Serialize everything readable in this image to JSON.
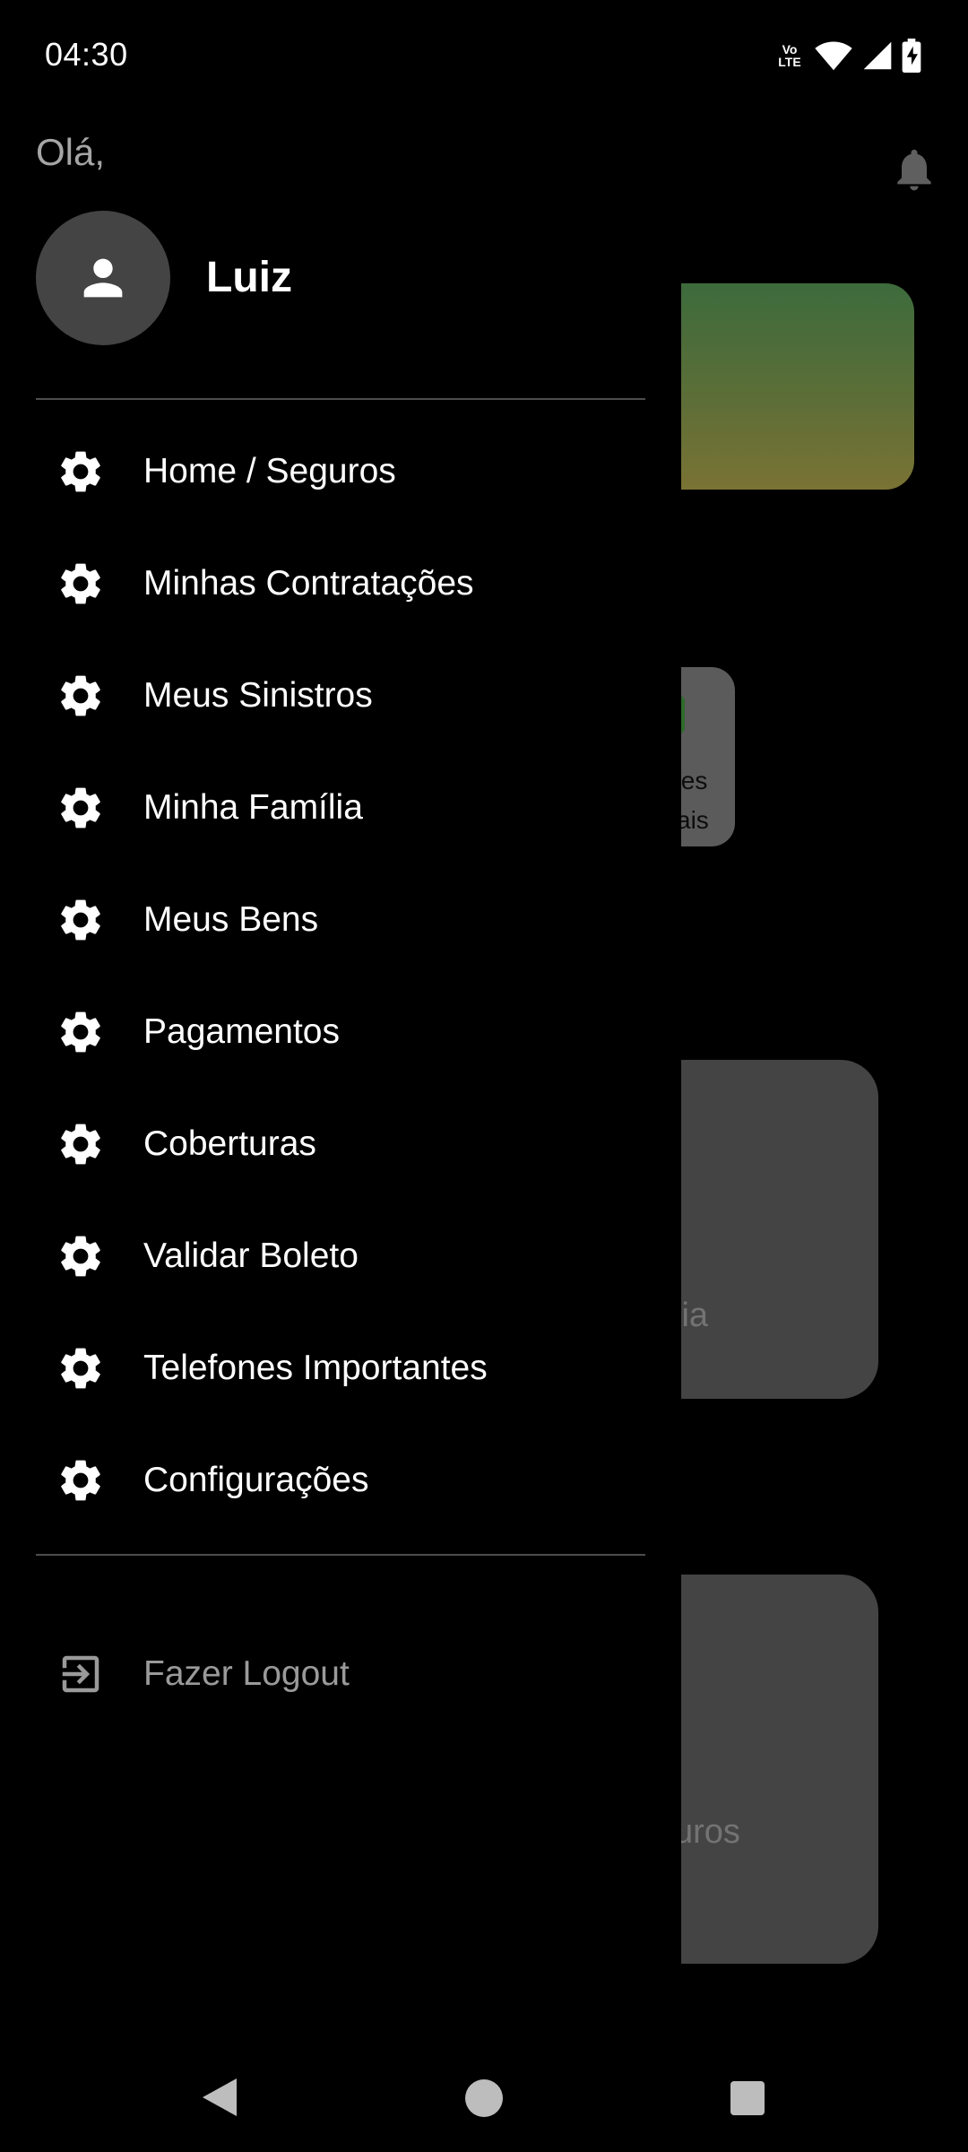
{
  "status_bar": {
    "time": "04:30",
    "volte_top": "Vo",
    "volte_bottom": "LTE",
    "icons": [
      "volte-icon",
      "wifi-icon",
      "signal-icon",
      "battery-charging-icon"
    ]
  },
  "background_page": {
    "bell_icon": "bell-icon",
    "small_card_text_line1": "tes",
    "small_card_text_line2": "ais",
    "card1_text": "lia",
    "card2_text": "uros",
    "banner_colors": [
      "#3d6b3c",
      "#7a7334"
    ]
  },
  "drawer": {
    "greeting": "Olá,",
    "avatar_icon": "person-icon",
    "user_name": "Luiz",
    "menu_items": [
      {
        "label": "Home / Seguros",
        "icon": "gear-icon"
      },
      {
        "label": "Minhas Contratações",
        "icon": "gear-icon"
      },
      {
        "label": "Meus Sinistros",
        "icon": "gear-icon"
      },
      {
        "label": "Minha Família",
        "icon": "gear-icon"
      },
      {
        "label": "Meus Bens",
        "icon": "gear-icon"
      },
      {
        "label": "Pagamentos",
        "icon": "gear-icon"
      },
      {
        "label": "Coberturas",
        "icon": "gear-icon"
      },
      {
        "label": "Validar Boleto",
        "icon": "gear-icon"
      },
      {
        "label": "Telefones Importantes",
        "icon": "gear-icon"
      },
      {
        "label": "Configurações",
        "icon": "gear-icon"
      }
    ],
    "logout": {
      "label": "Fazer Logout",
      "icon": "logout-icon"
    }
  },
  "nav_bar": {
    "buttons": [
      "back-icon",
      "home-icon",
      "recents-icon"
    ]
  },
  "colors": {
    "background": "#000000",
    "text_primary": "#ffffff",
    "text_secondary": "#a5a5a5",
    "divider": "#4d4d4d",
    "avatar_bg": "#444444",
    "card_bg": "#444444"
  }
}
